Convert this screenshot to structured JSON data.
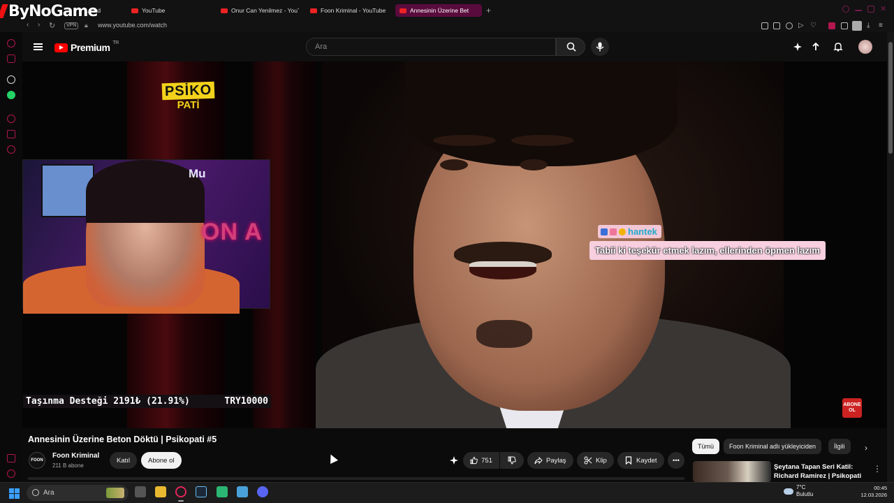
{
  "overlay_logo": "ByNoGame",
  "browser": {
    "tabs": [
      {
        "label": "...oard"
      },
      {
        "label": "YouTube"
      },
      {
        "label": "Onur Can Yenilmez - YouT"
      },
      {
        "label": "Foon Kriminal - YouTube"
      },
      {
        "label": "Annesinin Üzerine Bet"
      }
    ],
    "vpn": "VPN",
    "url": "www.youtube.com/watch"
  },
  "youtube": {
    "logo": "Premium",
    "country": "TR",
    "search_placeholder": "Ara"
  },
  "video_overlay": {
    "brand_line1": "PSİKO",
    "brand_line2": "PATİ",
    "cam_label": "Mu",
    "cam_neon": "ON A",
    "donation_label": "Taşınma Desteği 2191₺ (21.91%)",
    "donation_goal": "TRY10000",
    "donation_progress": 0.2191,
    "chat_user": "hantek",
    "chat_message": "Tabii ki teşekür etmek lazım, ellerinden öpmen lazım",
    "abone_badge": "ABONE OL"
  },
  "video": {
    "title": "Annesinin Üzerine Beton Döktü | Psikopati #5",
    "channel": "Foon Kriminal",
    "channel_avatar_text": "FOON",
    "subscribers": "211 B abone",
    "join_label": "Katıl",
    "subscribe_label": "Abone ol",
    "likes": "751",
    "share_label": "Paylaş",
    "clip_label": "Klip",
    "save_label": "Kaydet"
  },
  "recommendations": {
    "chips": [
      "Tümü",
      "Foon Kriminal adlı yükleyiciden",
      "İlgili"
    ],
    "first_title": "Şeytana Tapan Seri Katil: Richard Ramirez | Psikopati"
  },
  "taskbar": {
    "search_label": "Ara",
    "weather_temp": "7°C",
    "weather_desc": "Bulutlu",
    "time": "00:45",
    "date": "12.03.2026"
  },
  "colors": {
    "accent": "#ff0000",
    "browser_accent": "#b1164f",
    "chat_bg": "#f7cfdf"
  }
}
